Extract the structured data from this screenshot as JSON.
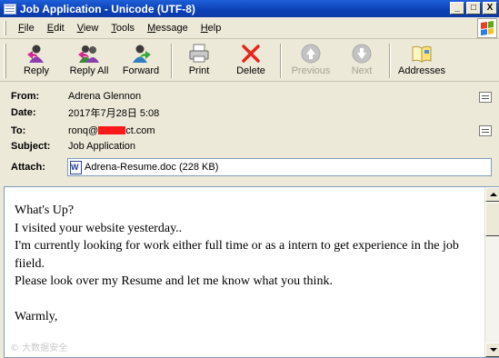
{
  "window": {
    "title": "Job Application - Unicode (UTF-8)",
    "controls": {
      "minimize": "_",
      "maximize": "□",
      "close": "X"
    }
  },
  "menu": {
    "items": [
      {
        "label": "File",
        "accel": "F"
      },
      {
        "label": "Edit",
        "accel": "E"
      },
      {
        "label": "View",
        "accel": "V"
      },
      {
        "label": "Tools",
        "accel": "T"
      },
      {
        "label": "Message",
        "accel": "M"
      },
      {
        "label": "Help",
        "accel": "H"
      }
    ]
  },
  "toolbar": {
    "reply": "Reply",
    "reply_all": "Reply All",
    "forward": "Forward",
    "print": "Print",
    "delete": "Delete",
    "previous": "Previous",
    "next": "Next",
    "addresses": "Addresses"
  },
  "header": {
    "from_label": "From:",
    "from_value": "Adrena Glennon",
    "date_label": "Date:",
    "date_value": "2017年7月28日 5:08",
    "to_label": "To:",
    "to_prefix": "ronq@",
    "to_suffix": "ct.com",
    "subject_label": "Subject:",
    "subject_value": "Job Application",
    "attach_label": "Attach:",
    "attachment": "Adrena-Resume.doc (228 KB)"
  },
  "body": {
    "lines": [
      "What's Up?",
      "I visited your website yesterday..",
      "I'm currently looking for work either full time or as a intern to get experience in the job fiield.",
      "Please look over my Resume and let me know what you think.",
      "",
      "Warmly,"
    ],
    "watermark": "© 大数据安全"
  },
  "colors": {
    "titlebar": "#0a3fb5",
    "chrome": "#ece9d8",
    "delete_red": "#e8261a",
    "redaction": "#ff1a1a"
  }
}
